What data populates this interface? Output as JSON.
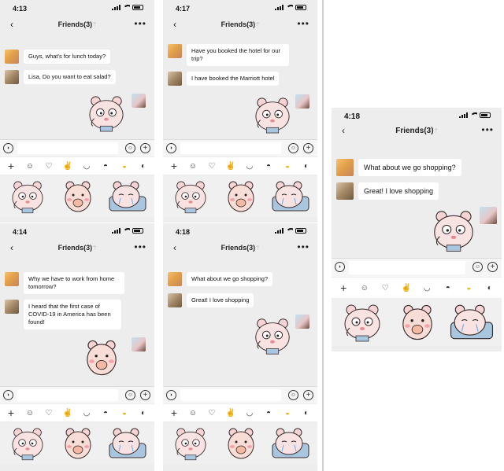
{
  "screens": [
    {
      "id": "s1",
      "time": "4:13",
      "title": "Friends(3)",
      "messages": [
        {
          "text": "Guys, what's for lunch today?"
        },
        {
          "text": "Lisa, Do you want to eat salad?"
        }
      ]
    },
    {
      "id": "s2",
      "time": "4:17",
      "title": "Friends(3)",
      "messages": [
        {
          "text": "Have you booked the hotel for our trip?"
        },
        {
          "text": "I have booked the Marriott hotel"
        }
      ]
    },
    {
      "id": "s3",
      "time": "4:14",
      "title": "Friends(3)",
      "messages": [
        {
          "text": "Why we have to work from home tomorrow?"
        },
        {
          "text": "I heard that the first case of COVID-19 in America has been found!"
        }
      ]
    },
    {
      "id": "s4",
      "time": "4:18",
      "title": "Friends(3)",
      "messages": [
        {
          "text": "What about we go shopping?"
        },
        {
          "text": "Great! I love shopping"
        }
      ]
    },
    {
      "id": "s5",
      "time": "4:18",
      "title": "Friends(3)",
      "messages": [
        {
          "text": "What about we go shopping?"
        },
        {
          "text": "Great! I love shopping"
        }
      ]
    }
  ],
  "icons": {
    "back": "‹",
    "more": "•••",
    "bell_muted": "⍑",
    "voice": "◗",
    "sticker": "☺",
    "plus": "+",
    "tray_plus": "+",
    "tray_smile": "☺",
    "tray_heart": "♡",
    "tray_hand": "✌"
  },
  "colors": {
    "chat_background": "#ededed",
    "bubble": "#ffffff",
    "bear_pink": "#f6d3d4",
    "bear_blue": "#a9c6e0"
  }
}
